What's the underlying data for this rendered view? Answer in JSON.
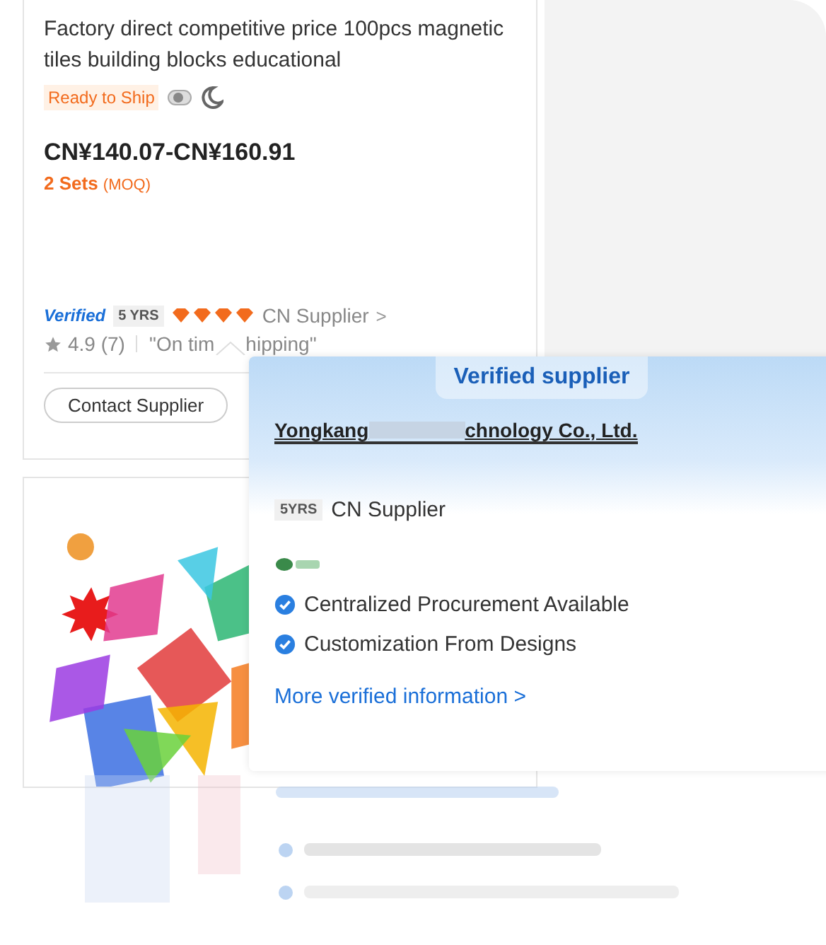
{
  "product": {
    "title": "Factory direct competitive price 100pcs magnetic tiles building blocks educational",
    "badge": "Ready to Ship",
    "price": "CN¥140.07-CN¥160.91",
    "moq": "2 Sets",
    "moq_note": "(MOQ)",
    "verified": "Verified",
    "years": "5 YRS",
    "stars": 4,
    "supplier": "CN Supplier",
    "supplier_caret": ">",
    "rating": "4.9 (7)",
    "highlight_start": "\"On tim",
    "highlight_end": "hipping\"",
    "contact": "Contact Supplier"
  },
  "popup": {
    "header": "Verified supplier",
    "company_start": "Yongkang",
    "company_end": "chnology Co., Ltd.",
    "years": "5YRS",
    "supplier": "CN Supplier",
    "features": [
      "Centralized Procurement Available",
      "Customization From Designs"
    ],
    "link": "More verified information >"
  }
}
